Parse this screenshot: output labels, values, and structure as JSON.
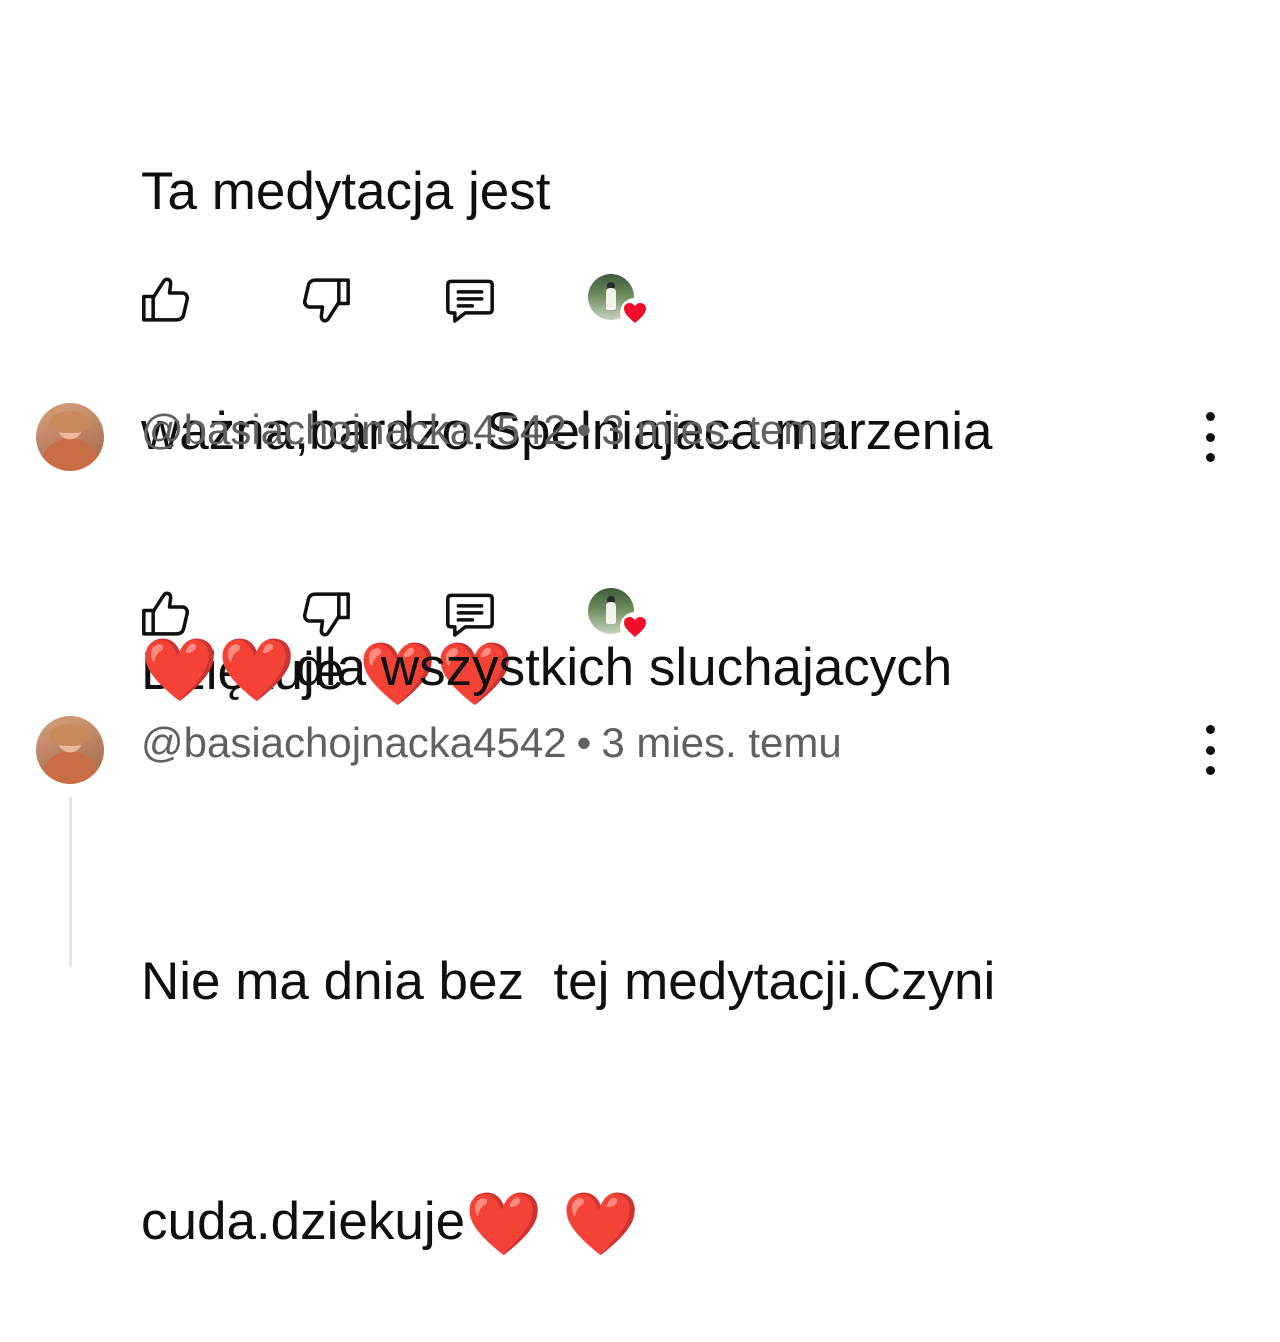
{
  "colors": {
    "text": "#0f0f0f",
    "meta": "#606060",
    "heart": "#e0161c",
    "thread_line": "#e5e5e5"
  },
  "comments": [
    {
      "lines": [
        "Ta medytacja jest",
        "ważna,bardzo.Spelniajaca marzenia",
        "Dziękuje "
      ],
      "hearts_line_index": 2,
      "hearts": "❤️❤️",
      "actions": {
        "like_icon": "thumbs-up-icon",
        "dislike_icon": "thumbs-down-icon",
        "reply_icon": "reply-comment-icon",
        "creator_heart": "creator-heart-badge"
      }
    },
    {
      "author": "@basiachojnacka4542",
      "separator": "•",
      "time": "3 mies. temu",
      "prefix_hearts": "❤️❤️",
      "text": "dla wszystkich sluchajacych",
      "actions": {
        "like_icon": "thumbs-up-icon",
        "dislike_icon": "thumbs-down-icon",
        "reply_icon": "reply-comment-icon",
        "creator_heart": "creator-heart-badge"
      }
    },
    {
      "author": "@basiachojnacka4542",
      "separator": "•",
      "time": "3 mies. temu",
      "lines": [
        "Nie ma dnia bez  tej medytacji.Czyni",
        "cuda.dziekuje"
      ],
      "suffix_hearts": "❤️ ❤️"
    }
  ]
}
